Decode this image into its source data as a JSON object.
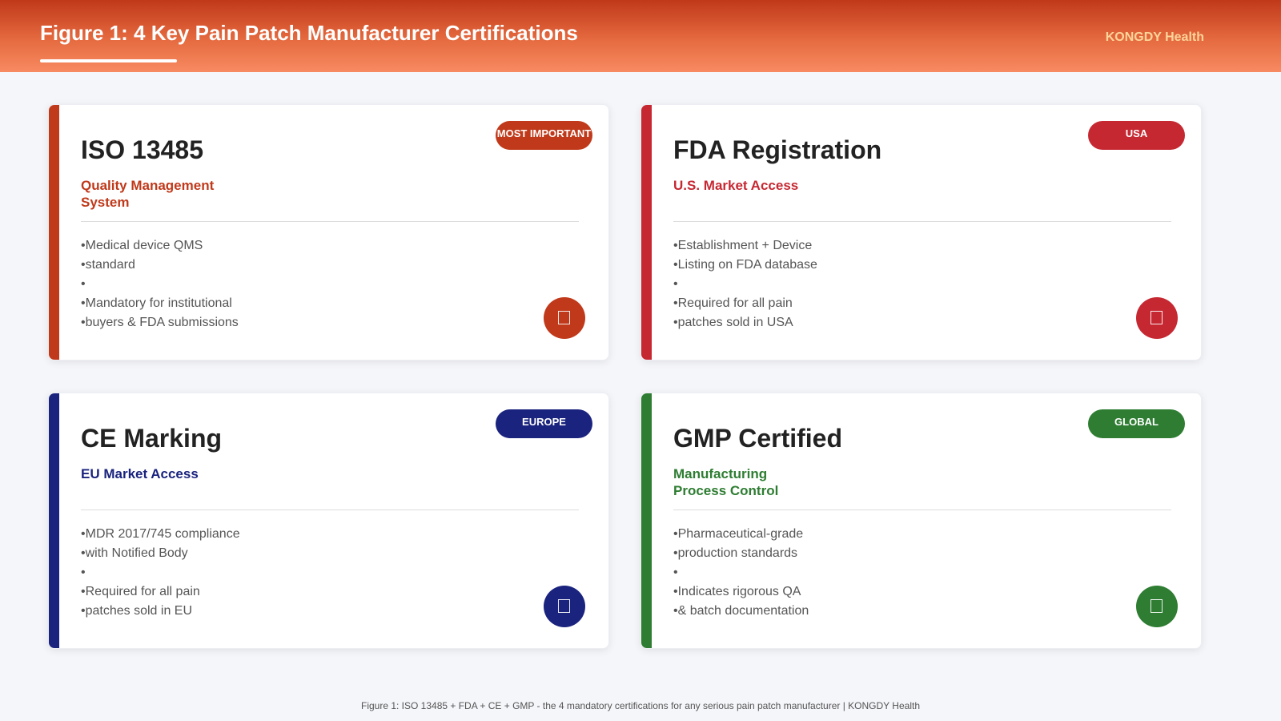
{
  "header": {
    "title": "Figure 1: 4 Key Pain Patch Manufacturer Certifications",
    "brand": "KONGDY Health"
  },
  "cards": [
    {
      "title": "ISO 13485",
      "subtitle": "Quality Management System",
      "badge": "MOST IMPORTANT",
      "accent": "#c0391a",
      "items": [
        "Medical device QMS",
        "standard",
        "",
        "Mandatory for institutional",
        "buyers & FDA submissions"
      ]
    },
    {
      "title": "FDA Registration",
      "subtitle": "U.S. Market Access",
      "badge": "USA",
      "accent": "#c62832",
      "items": [
        "Establishment + Device",
        "Listing on FDA database",
        "",
        "Required for all pain",
        "patches sold in USA"
      ]
    },
    {
      "title": "CE Marking",
      "subtitle": "EU Market Access",
      "badge": "EUROPE",
      "accent": "#1a237e",
      "items": [
        "MDR 2017/745 compliance",
        "with Notified Body",
        "",
        "Required for all pain",
        "patches sold in EU"
      ]
    },
    {
      "title": "GMP Certified",
      "subtitle": "Manufacturing Process Control",
      "badge": "GLOBAL",
      "accent": "#2e7d32",
      "items": [
        "Pharmaceutical-grade",
        "production standards",
        "",
        "Indicates rigorous QA",
        "& batch documentation"
      ]
    }
  ],
  "caption": "Figure 1: ISO 13485 + FDA + CE + GMP - the 4 mandatory certifications for any serious pain patch manufacturer | KONGDY Health"
}
